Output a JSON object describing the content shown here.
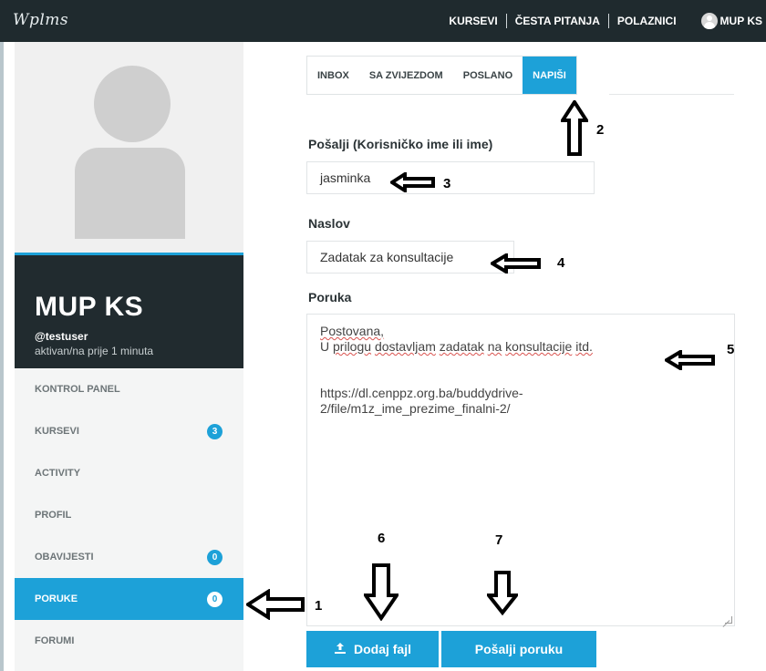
{
  "header": {
    "logo": "Wplms",
    "nav": [
      "KURSEVI",
      "ČESTA PITANJA",
      "POLAZNICI"
    ],
    "user_label": "MUP KS"
  },
  "profile": {
    "name": "MUP KS",
    "handle": "@testuser",
    "status": "aktivan/na prije 1 minuta"
  },
  "sidebar": {
    "items": [
      {
        "label": "KONTROL PANEL",
        "badge": ""
      },
      {
        "label": "KURSEVI",
        "badge": "3"
      },
      {
        "label": "ACTIVITY",
        "badge": ""
      },
      {
        "label": "PROFIL",
        "badge": ""
      },
      {
        "label": "OBAVIJESTI",
        "badge": "0"
      },
      {
        "label": "PORUKE",
        "badge": "0"
      },
      {
        "label": "FORUMI",
        "badge": ""
      }
    ],
    "active_index": 5
  },
  "tabs": [
    "INBOX",
    "SA ZVIJEZDOM",
    "POSLANO",
    "NAPIŠI"
  ],
  "form": {
    "recipient_label": "Pošalji (Korisničko ime ili ime)",
    "recipient_value": "jasminka",
    "subject_label": "Naslov",
    "subject_value": "Zadatak za konsultacije",
    "message_label": "Poruka",
    "message_lines": [
      "Postovana,",
      "U prilogu dostavljam zadatak na konsultacije itd.",
      "",
      "https://dl.cenppz.org.ba/buddydrive-",
      "2/file/m1z_ime_prezime_finalni-2/"
    ]
  },
  "buttons": {
    "attach": "Dodaj fajl",
    "attach_icon": "upload-icon",
    "send": "Pošalji poruku"
  },
  "annotations": [
    "1",
    "2",
    "3",
    "4",
    "5",
    "6",
    "7"
  ],
  "colors": {
    "accent": "#1da1d8",
    "topbar": "#1f2a2e",
    "profile_bg": "#212b2f"
  }
}
